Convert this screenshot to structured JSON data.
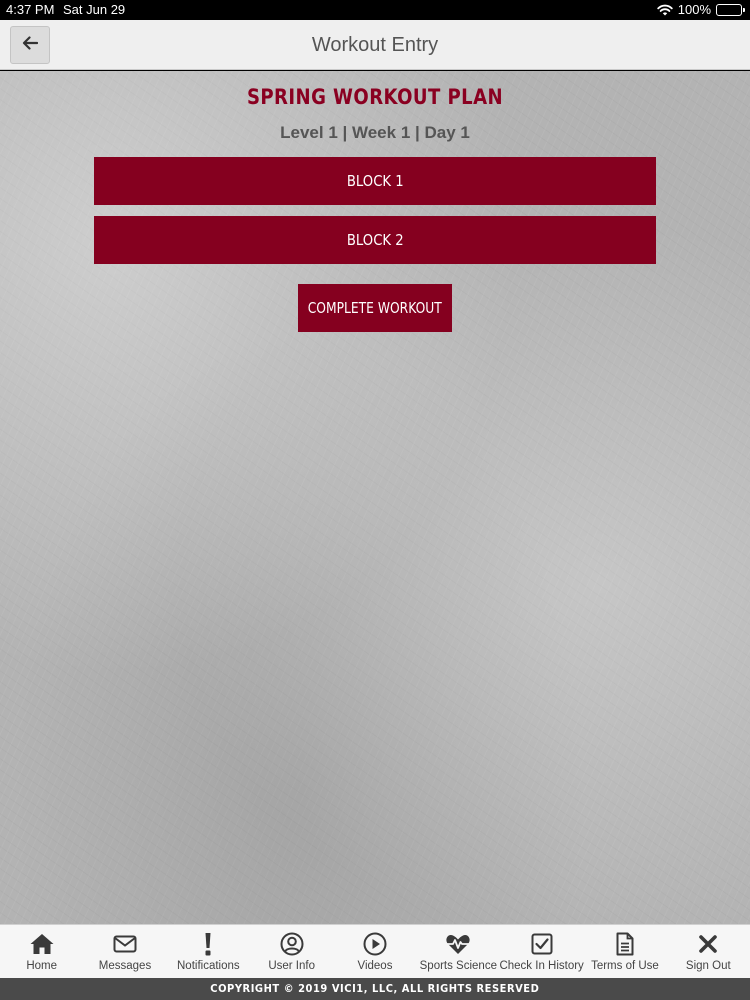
{
  "status_bar": {
    "time": "4:37 PM",
    "date": "Sat Jun 29",
    "battery": "100%",
    "battery_level": 1.0
  },
  "header": {
    "title": "Workout Entry",
    "back_icon": "arrow-left-icon"
  },
  "workout": {
    "title": "SPRING WORKOUT PLAN",
    "subtitle": "Level 1 | Week 1 | Day 1",
    "blocks": [
      {
        "label": "BLOCK 1"
      },
      {
        "label": "BLOCK 2"
      }
    ],
    "complete_label": "COMPLETE WORKOUT"
  },
  "tab_bar": {
    "items": [
      {
        "label": "Home",
        "icon": "home-icon"
      },
      {
        "label": "Messages",
        "icon": "envelope-icon"
      },
      {
        "label": "Notifications",
        "icon": "exclamation-icon"
      },
      {
        "label": "User Info",
        "icon": "user-circle-icon"
      },
      {
        "label": "Videos",
        "icon": "play-circle-icon"
      },
      {
        "label": "Sports Science",
        "icon": "heartbeat-icon"
      },
      {
        "label": "Check In History",
        "icon": "checkbox-icon"
      },
      {
        "label": "Terms of Use",
        "icon": "document-icon"
      },
      {
        "label": "Sign Out",
        "icon": "close-icon"
      }
    ]
  },
  "footer": {
    "copyright": "COPYRIGHT © 2019 VICI1, LLC, ALL RIGHTS RESERVED"
  },
  "colors": {
    "brand": "#85001f",
    "title_text": "#8a0021",
    "background": "#b3b3b3"
  }
}
